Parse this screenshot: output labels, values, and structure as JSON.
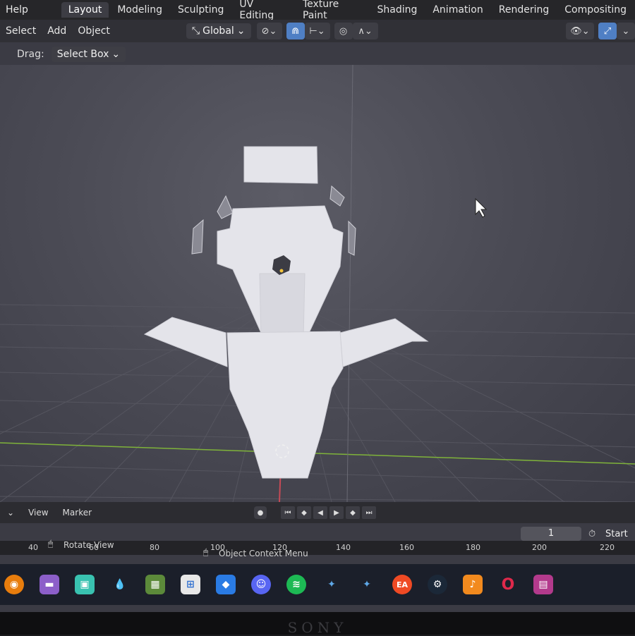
{
  "topbar": {
    "menu_help": "Help",
    "tabs": [
      "Layout",
      "Modeling",
      "Sculpting",
      "UV Editing",
      "Texture Paint",
      "Shading",
      "Animation",
      "Rendering",
      "Compositing"
    ],
    "active_tab": "Layout"
  },
  "header": {
    "select": "Select",
    "add": "Add",
    "object": "Object",
    "orientation": "Global"
  },
  "tool_settings": {
    "drag_label": "Drag:",
    "drag_value": "Select Box"
  },
  "timeline": {
    "view": "View",
    "marker": "Marker",
    "current_frame": "1",
    "start_label": "Start",
    "ruler_ticks": [
      "40",
      "60",
      "80",
      "100",
      "120",
      "140",
      "160",
      "180",
      "200",
      "220"
    ]
  },
  "statusbar": {
    "rotate_view": "Rotate View",
    "object_context_menu": "Object Context Menu"
  },
  "taskbar": {
    "icons": [
      "blender-icon",
      "files-icon",
      "app-icon",
      "drop-icon",
      "minecraft-icon",
      "store-icon",
      "roblox-icon",
      "discord-icon",
      "spotify-icon",
      "blender-launcher-icon",
      "blender-launcher-2-icon",
      "ea-icon",
      "steam-icon",
      "fl-studio-icon",
      "opera-icon",
      "winrar-icon"
    ]
  },
  "monitor_brand": "SONY",
  "colors": {
    "accent": "#4f7fc4",
    "x_axis": "#c64a56",
    "y_axis": "#7fb33a"
  }
}
